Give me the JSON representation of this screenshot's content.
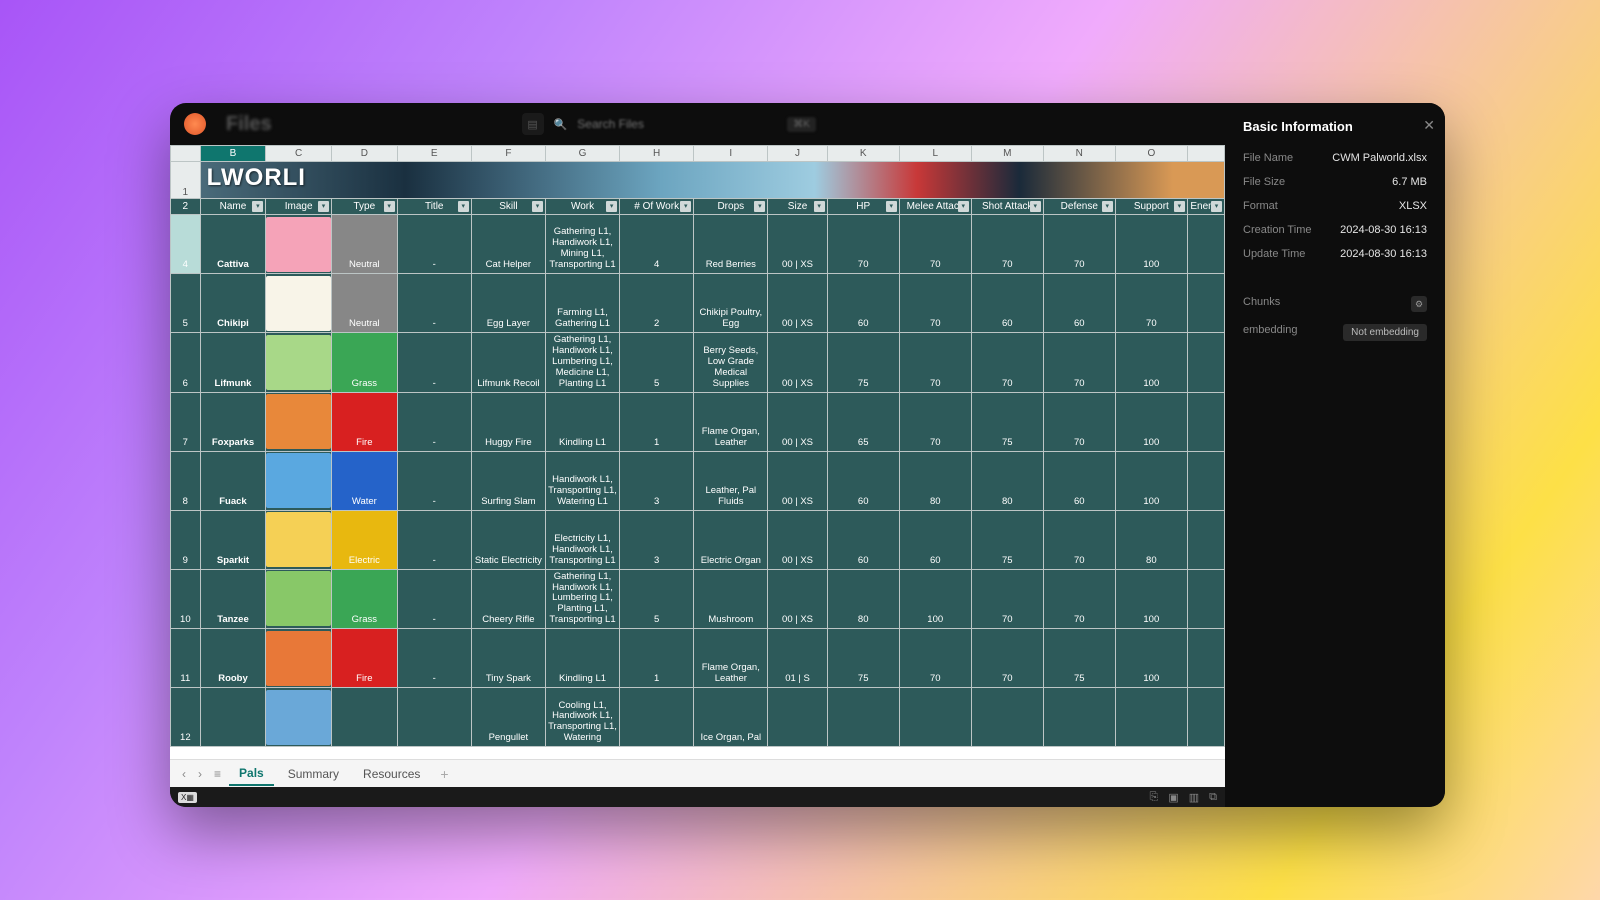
{
  "topbar": {
    "title": "Files",
    "search_placeholder": "Search Files",
    "kbd": "⌘K"
  },
  "columns": [
    "",
    "B",
    "C",
    "D",
    "E",
    "F",
    "G",
    "H",
    "I",
    "J",
    "K",
    "L",
    "M",
    "N",
    "O",
    ""
  ],
  "banner_text": "LWORLI",
  "headers": [
    "Name",
    "Image",
    "Type",
    "Title",
    "Skill",
    "Work",
    "# Of Work",
    "Drops",
    "Size",
    "HP",
    "Melee Attack",
    "Shot Attack",
    "Defense",
    "Support",
    "Enemy"
  ],
  "rows": [
    {
      "num": "4",
      "sel": true,
      "name": "Cattiva",
      "type": "Neutral",
      "tcls": "type-neutral",
      "title": "-",
      "skill": "Cat Helper",
      "work": "Gathering L1, Handiwork L1, Mining L1, Transporting L1",
      "numwork": "4",
      "drops": "Red Berries",
      "size": "00 | XS",
      "hp": "70",
      "melee": "70",
      "shot": "70",
      "def": "70",
      "sup": "100"
    },
    {
      "num": "5",
      "name": "Chikipi",
      "type": "Neutral",
      "tcls": "type-neutral",
      "title": "-",
      "skill": "Egg Layer",
      "work": "Farming L1, Gathering L1",
      "numwork": "2",
      "drops": "Chikipi Poultry, Egg",
      "size": "00 | XS",
      "hp": "60",
      "melee": "70",
      "shot": "60",
      "def": "60",
      "sup": "70"
    },
    {
      "num": "6",
      "name": "Lifmunk",
      "type": "Grass",
      "tcls": "type-grass",
      "title": "-",
      "skill": "Lifmunk Recoil",
      "work": "Gathering L1, Handiwork L1, Lumbering L1, Medicine L1, Planting L1",
      "numwork": "5",
      "drops": "Berry Seeds, Low Grade Medical Supplies",
      "size": "00 | XS",
      "hp": "75",
      "melee": "70",
      "shot": "70",
      "def": "70",
      "sup": "100"
    },
    {
      "num": "7",
      "name": "Foxparks",
      "type": "Fire",
      "tcls": "type-fire",
      "title": "-",
      "skill": "Huggy Fire",
      "work": "Kindling L1",
      "numwork": "1",
      "drops": "Flame Organ, Leather",
      "size": "00 | XS",
      "hp": "65",
      "melee": "70",
      "shot": "75",
      "def": "70",
      "sup": "100"
    },
    {
      "num": "8",
      "name": "Fuack",
      "type": "Water",
      "tcls": "type-water",
      "title": "-",
      "skill": "Surfing Slam",
      "work": "Handiwork L1, Transporting L1, Watering L1",
      "numwork": "3",
      "drops": "Leather, Pal Fluids",
      "size": "00 | XS",
      "hp": "60",
      "melee": "80",
      "shot": "80",
      "def": "60",
      "sup": "100"
    },
    {
      "num": "9",
      "name": "Sparkit",
      "type": "Electric",
      "tcls": "type-electric",
      "title": "-",
      "skill": "Static Electricity",
      "work": "Electricity L1, Handiwork L1, Transporting L1",
      "numwork": "3",
      "drops": "Electric Organ",
      "size": "00 | XS",
      "hp": "60",
      "melee": "60",
      "shot": "75",
      "def": "70",
      "sup": "80"
    },
    {
      "num": "10",
      "name": "Tanzee",
      "type": "Grass",
      "tcls": "type-grass",
      "title": "-",
      "skill": "Cheery Rifle",
      "work": "Gathering L1, Handiwork L1, Lumbering L1, Planting L1, Transporting L1",
      "numwork": "5",
      "drops": "Mushroom",
      "size": "00 | XS",
      "hp": "80",
      "melee": "100",
      "shot": "70",
      "def": "70",
      "sup": "100"
    },
    {
      "num": "11",
      "name": "Rooby",
      "type": "Fire",
      "tcls": "type-fire",
      "title": "-",
      "skill": "Tiny Spark",
      "work": "Kindling L1",
      "numwork": "1",
      "drops": "Flame Organ, Leather",
      "size": "01 | S",
      "hp": "75",
      "melee": "70",
      "shot": "70",
      "def": "75",
      "sup": "100"
    },
    {
      "num": "12",
      "name": "",
      "type": "",
      "tcls": "",
      "title": "",
      "skill": "Pengullet",
      "work": "Cooling L1, Handiwork L1, Transporting L1, Watering",
      "numwork": "",
      "drops": "Ice Organ, Pal",
      "size": "",
      "hp": "",
      "melee": "",
      "shot": "",
      "def": "",
      "sup": ""
    }
  ],
  "tabs": {
    "pals": "Pals",
    "summary": "Summary",
    "resources": "Resources"
  },
  "side": {
    "title": "Basic Information",
    "filename_l": "File Name",
    "filename": "CWM Palworld.xlsx",
    "filesize_l": "File Size",
    "filesize": "6.7 MB",
    "format_l": "Format",
    "format": "XLSX",
    "creation_l": "Creation Time",
    "creation": "2024-08-30 16:13",
    "update_l": "Update Time",
    "update": "2024-08-30 16:13",
    "chunks_l": "Chunks",
    "embed_l": "embedding",
    "embed": "Not embedding"
  }
}
